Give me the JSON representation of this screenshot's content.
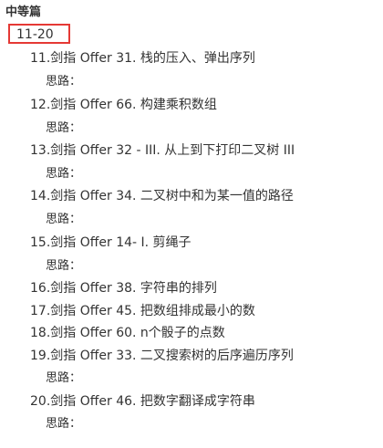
{
  "section": {
    "title": "中等篇",
    "range": "11-20"
  },
  "items": [
    {
      "label": "11.剑指 Offer 31. 栈的压入、弹出序列",
      "note": "思路："
    },
    {
      "label": "12.剑指 Offer 66. 构建乘积数组",
      "note": "思路："
    },
    {
      "label": "13.剑指 Offer 32 - III. 从上到下打印二叉树 III",
      "note": "思路："
    },
    {
      "label": "14.剑指 Offer 34. 二叉树中和为某一值的路径",
      "note": "思路："
    },
    {
      "label": "15.剑指 Offer 14- I. 剪绳子",
      "note": "思路："
    },
    {
      "label": "16.剑指 Offer 38. 字符串的排列"
    },
    {
      "label": "17.剑指 Offer 45. 把数组排成最小的数"
    },
    {
      "label": "18.剑指 Offer 60. n个骰子的点数"
    },
    {
      "label": "19.剑指 Offer 33. 二叉搜索树的后序遍历序列",
      "note": "思路："
    },
    {
      "label": "20.剑指 Offer 46. 把数字翻译成字符串",
      "note": "思路："
    }
  ],
  "colors": {
    "highlight_border": "#e53935",
    "text": "#333333"
  }
}
